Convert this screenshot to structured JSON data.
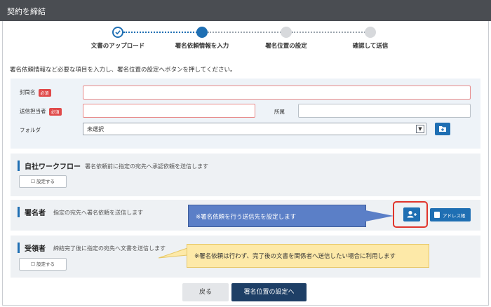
{
  "window": {
    "title": "契約を締結"
  },
  "stepper": {
    "steps": [
      {
        "label": "文書のアップロード",
        "state": "done"
      },
      {
        "label": "署名依頼情報を入力",
        "state": "current"
      },
      {
        "label": "署名位置の設定",
        "state": "todo"
      },
      {
        "label": "確認して送信",
        "state": "todo"
      }
    ]
  },
  "instruction": "署名依頼情報など必要な項目を入力し、署名位置の設定へボタンを押してください。",
  "form": {
    "envelope_label": "封筒名",
    "sender_label": "送信担当者",
    "required_badge": "必須",
    "affiliation_label": "所属",
    "folder_label": "フォルダ",
    "folder_value": "未選択",
    "envelope_value": "",
    "sender_value": "",
    "affiliation_value": ""
  },
  "workflow": {
    "title": "自社ワークフロー",
    "desc": "署名依頼前に指定の宛先へ承認依頼を送信します",
    "button": "設定する"
  },
  "signer": {
    "title": "署名者",
    "desc": "指定の宛先へ署名依頼を送信します",
    "address_book_button": "アドレス帳"
  },
  "recipient": {
    "title": "受領者",
    "desc": "締結完了後に指定の宛先へ文書を送信します",
    "button": "設定する"
  },
  "callouts": {
    "signer_note": "※署名依頼を行う送信先を設定します",
    "recipient_note": "※署名依頼は行わず、完了後の文書を関係者へ送信したい場合に利用します"
  },
  "footer": {
    "back": "戻る",
    "next": "署名位置の設定へ"
  },
  "colors": {
    "primary": "#1f6fb3",
    "titlebar": "#4a4d52",
    "required": "#e04a4a",
    "next_button": "#1e3f66"
  }
}
